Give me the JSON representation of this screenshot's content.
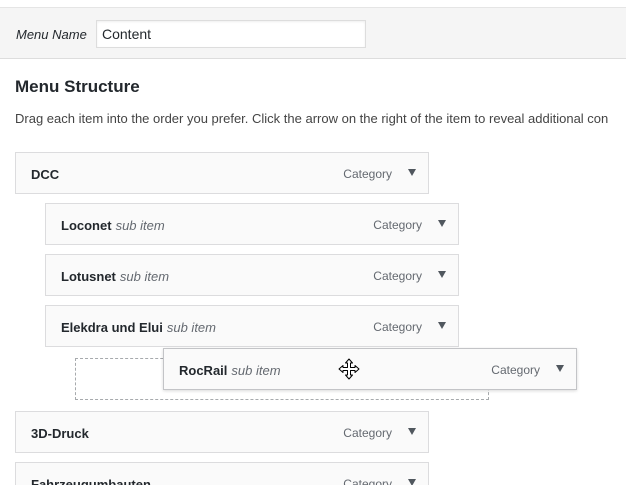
{
  "menu_name": {
    "label": "Menu Name",
    "value": "Content"
  },
  "structure": {
    "title": "Menu Structure",
    "instructions": "Drag each item into the order you prefer. Click the arrow on the right of the item to reveal additional con"
  },
  "items": [
    {
      "title": "DCC",
      "sub_label": "",
      "type": "Category",
      "depth": 0
    },
    {
      "title": "Loconet",
      "sub_label": "sub item",
      "type": "Category",
      "depth": 1
    },
    {
      "title": "Lotusnet",
      "sub_label": "sub item",
      "type": "Category",
      "depth": 1
    },
    {
      "title": "Elekdra und Elui",
      "sub_label": "sub item",
      "type": "Category",
      "depth": 1
    },
    {
      "title": "RocRail",
      "sub_label": "sub item",
      "type": "Category",
      "depth": 2,
      "dragging": true
    },
    {
      "title": "3D-Druck",
      "sub_label": "",
      "type": "Category",
      "depth": 0
    },
    {
      "title": "Fahrzeugumbauten",
      "sub_label": "",
      "type": "Category",
      "depth": 0
    }
  ],
  "icons": {
    "item_arrow": "triangle-down-icon",
    "cursor": "move-cursor-icon"
  }
}
